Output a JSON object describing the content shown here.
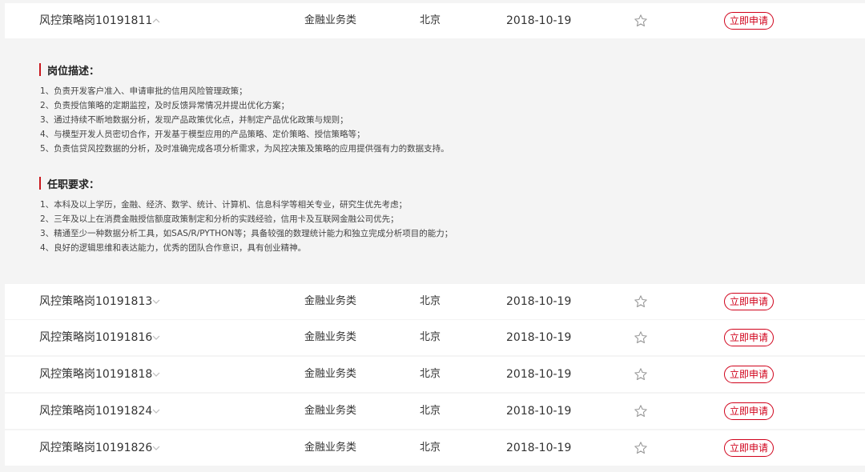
{
  "jobs": [
    {
      "title": "风控策略岗10191811",
      "category": "金融业务类",
      "city": "北京",
      "date": "2018-10-19",
      "apply": "立即申请"
    },
    {
      "title": "风控策略岗10191813",
      "category": "金融业务类",
      "city": "北京",
      "date": "2018-10-19",
      "apply": "立即申请"
    },
    {
      "title": "风控策略岗10191816",
      "category": "金融业务类",
      "city": "北京",
      "date": "2018-10-19",
      "apply": "立即申请"
    },
    {
      "title": "风控策略岗10191818",
      "category": "金融业务类",
      "city": "北京",
      "date": "2018-10-19",
      "apply": "立即申请"
    },
    {
      "title": "风控策略岗10191824",
      "category": "金融业务类",
      "city": "北京",
      "date": "2018-10-19",
      "apply": "立即申请"
    },
    {
      "title": "风控策略岗10191826",
      "category": "金融业务类",
      "city": "北京",
      "date": "2018-10-19",
      "apply": "立即申请"
    }
  ],
  "detail": {
    "duties_title": "岗位描述：",
    "duties": [
      "1、负责开发客户准入、申请审批的信用风险管理政策；",
      "2、负责授信策略的定期监控，及时反馈异常情况并提出优化方案；",
      "3、通过持续不断地数据分析，发现产品政策优化点，并制定产品优化政策与规则；",
      "4、与模型开发人员密切合作，开发基于模型应用的产品策略、定价策略、授信策略等；",
      "5、负责信贷风控数据的分析，及时准确完成各项分析需求，为风控决策及策略的应用提供强有力的数据支持。"
    ],
    "requirements_title": "任职要求：",
    "requirements": [
      "1、本科及以上学历，金融、经济、数学、统计、计算机、信息科学等相关专业，研究生优先考虑；",
      "2、三年及以上在消费金融授信额度政策制定和分析的实践经验，信用卡及互联网金融公司优先；",
      "3、精通至少一种数据分析工具，如SAS/R/PYTHON等；具备较强的数理统计能力和独立完成分析项目的能力；",
      "4、良好的逻辑思维和表达能力，优秀的团队合作意识，具有创业精神。"
    ]
  },
  "icons": {
    "expand": "chevron-down-icon",
    "collapse": "chevron-up-icon",
    "favorite": "star-outline-icon"
  },
  "colors": {
    "accent": "#d0021b",
    "section_bar": "#c9171e",
    "row_bg": "#ffffff",
    "page_bg": "#f4f4f4"
  }
}
